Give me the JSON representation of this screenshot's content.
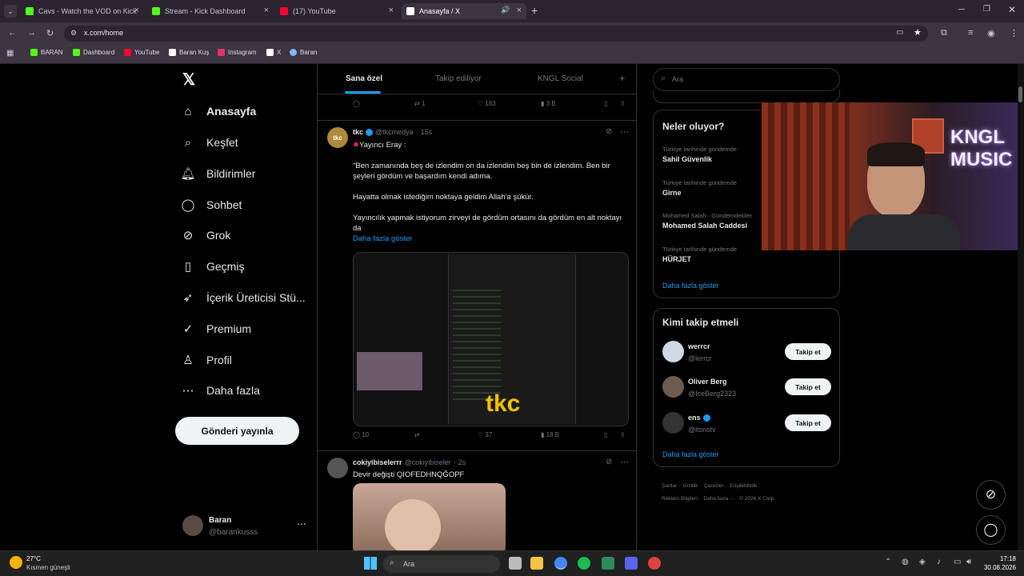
{
  "browser": {
    "tabs": [
      {
        "title": "Cavs - Watch the VOD on Kick",
        "color": "#53fc18"
      },
      {
        "title": "Stream - Kick Dashboard",
        "color": "#53fc18"
      },
      {
        "title": "(17) YouTube",
        "color": "#ff0033"
      },
      {
        "title": "Anasayfa / X",
        "color": "#ffffff"
      }
    ],
    "url": "x.com/home",
    "bookmarks": [
      {
        "label": "BARAN",
        "color": "#53fc18"
      },
      {
        "label": "Dashboard",
        "color": "#53fc18"
      },
      {
        "label": "YouTube",
        "color": "#ff0033"
      },
      {
        "label": "Baran Kuş",
        "color": "#ffffff"
      },
      {
        "label": "Instagram",
        "color": "#e1306c"
      },
      {
        "label": "X",
        "color": "#ffffff"
      },
      {
        "label": "Baran",
        "color": "#8ab4f8"
      }
    ]
  },
  "nav": {
    "items": [
      {
        "label": "Anasayfa",
        "icon": "home-icon"
      },
      {
        "label": "Keşfet",
        "icon": "search-icon"
      },
      {
        "label": "Bildirimler",
        "icon": "bell-icon"
      },
      {
        "label": "Sohbet",
        "icon": "chat-icon"
      },
      {
        "label": "Grok",
        "icon": "grok-icon"
      },
      {
        "label": "Geçmiş",
        "icon": "bookmark-icon"
      },
      {
        "label": "İçerik Üreticisi Stü...",
        "icon": "rocket-icon"
      },
      {
        "label": "Premium",
        "icon": "premium-icon"
      },
      {
        "label": "Profil",
        "icon": "user-icon"
      },
      {
        "label": "Daha fazla",
        "icon": "more-icon"
      }
    ],
    "post_button": "Gönderi yayınla",
    "user": {
      "name": "Baran",
      "handle": "@barankusss"
    }
  },
  "feed": {
    "tabs": [
      "Sana özel",
      "Takip ediliyor",
      "KNGL Social"
    ],
    "top_actions": {
      "replies": "",
      "retweets": "1",
      "likes": "163",
      "views": "3 B"
    },
    "tweet1": {
      "name": "tkc",
      "handle": "@tkcmedya",
      "time": "15s",
      "lines": [
        "Yayıncı Eray :",
        "\"Ben zamanında beş de izlendim on da izlendim beş bin de izlendim. Ben bir şeyleri gördüm ve başardım kendi adıma.",
        "Hayatta olmak istediğim noktaya geldim Allah'a şükür.",
        "Yayıncılık yapmak istiyorum zirveyi de gördüm ortasını da gördüm en alt noktayı da"
      ],
      "show_more": "Daha fazla göster",
      "media_logo": "tkc",
      "replies": "10",
      "retweets": "",
      "likes": "37",
      "views": "18 B"
    },
    "tweet2": {
      "name": "cokiyibiselerrr",
      "handle": "@cokiyibiseler",
      "time": "2s",
      "text": "Devir değişti QIOFEDHNQĞOPF"
    }
  },
  "sidebar": {
    "search_placeholder": "Ara",
    "trends_title": "Neler oluyor?",
    "trends": [
      {
        "context": "Türkiye tarihinde gündemde",
        "name": "Sahil Güvenlik"
      },
      {
        "context": "Türkiye tarihinde gündemde",
        "name": "Girne"
      },
      {
        "context": "Mohamed Salah · Gündemdekiler",
        "name": "Mohamed Salah Caddesi"
      },
      {
        "context": "Türkiye tarihinde gündemde",
        "name": "HÜRJET"
      }
    ],
    "trends_more": "Daha fazla göster",
    "who_title": "Kimi takip etmeli",
    "who": [
      {
        "name": "werrcr",
        "handle": "@lerrcr"
      },
      {
        "name": "Oliver Berg",
        "handle": "@IceBerg2323"
      },
      {
        "name": "ens",
        "handle": "@itsnstv"
      }
    ],
    "follow_label": "Takip et",
    "who_more": "Daha fazla göster",
    "footer": [
      "Şartlar",
      "Gizlilik",
      "Çerezler",
      "Erişilebilirlik",
      "Reklam Bilgileri",
      "Daha fazla ···",
      "© 2026 X Corp."
    ]
  },
  "webcam": {
    "sign_text_1": "KNGL",
    "sign_text_2": "MUSIC"
  },
  "taskbar": {
    "weather_temp": "27°C",
    "weather_desc": "Kısmen güneşli",
    "search": "Ara",
    "time": "17:18",
    "date": "30.08.2026"
  }
}
